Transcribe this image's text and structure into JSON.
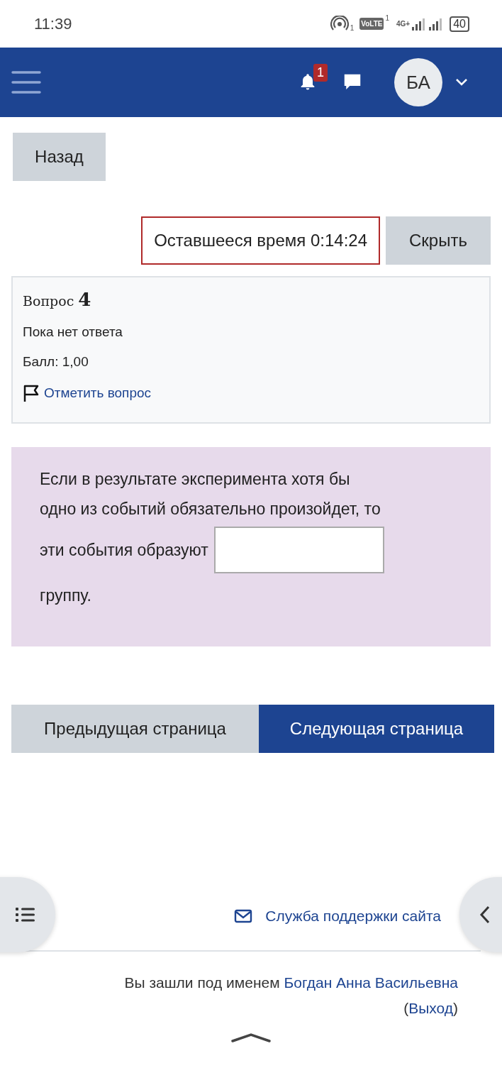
{
  "status_bar": {
    "time": "11:39",
    "hotspot_sim": "1",
    "volte": "VoLTE",
    "volte_sim": "1",
    "network": "4G+",
    "battery": "40"
  },
  "header": {
    "notifications": {
      "count": "1"
    },
    "avatar_initials": "БА"
  },
  "back_button": "Назад",
  "timer": {
    "label": "Оставшееся время 0:14:24",
    "hide_button": "Скрыть"
  },
  "question_info": {
    "label": "Вопрос",
    "number": "4",
    "status": "Пока нет ответа",
    "grade": "Балл: 1,00",
    "flag_link": "Отметить вопрос"
  },
  "question": {
    "lines_before": [
      "Если в результате эксперимента хотя бы",
      "одно из событий обязательно произойдет, то",
      "эти события образуют"
    ],
    "text_after": "группу."
  },
  "navigation": [
    {
      "label": "Предыдущая страница",
      "kind": "secondary"
    },
    {
      "label": "Следующая страница",
      "kind": "primary"
    }
  ],
  "footer": {
    "support_link": "Служба поддержки сайта",
    "login_prefix": "Вы зашли под именем",
    "user_link": "Богдан Анна Васильевна",
    "logout_open": "(",
    "logout_link": "Выход",
    "logout_close": ")"
  }
}
